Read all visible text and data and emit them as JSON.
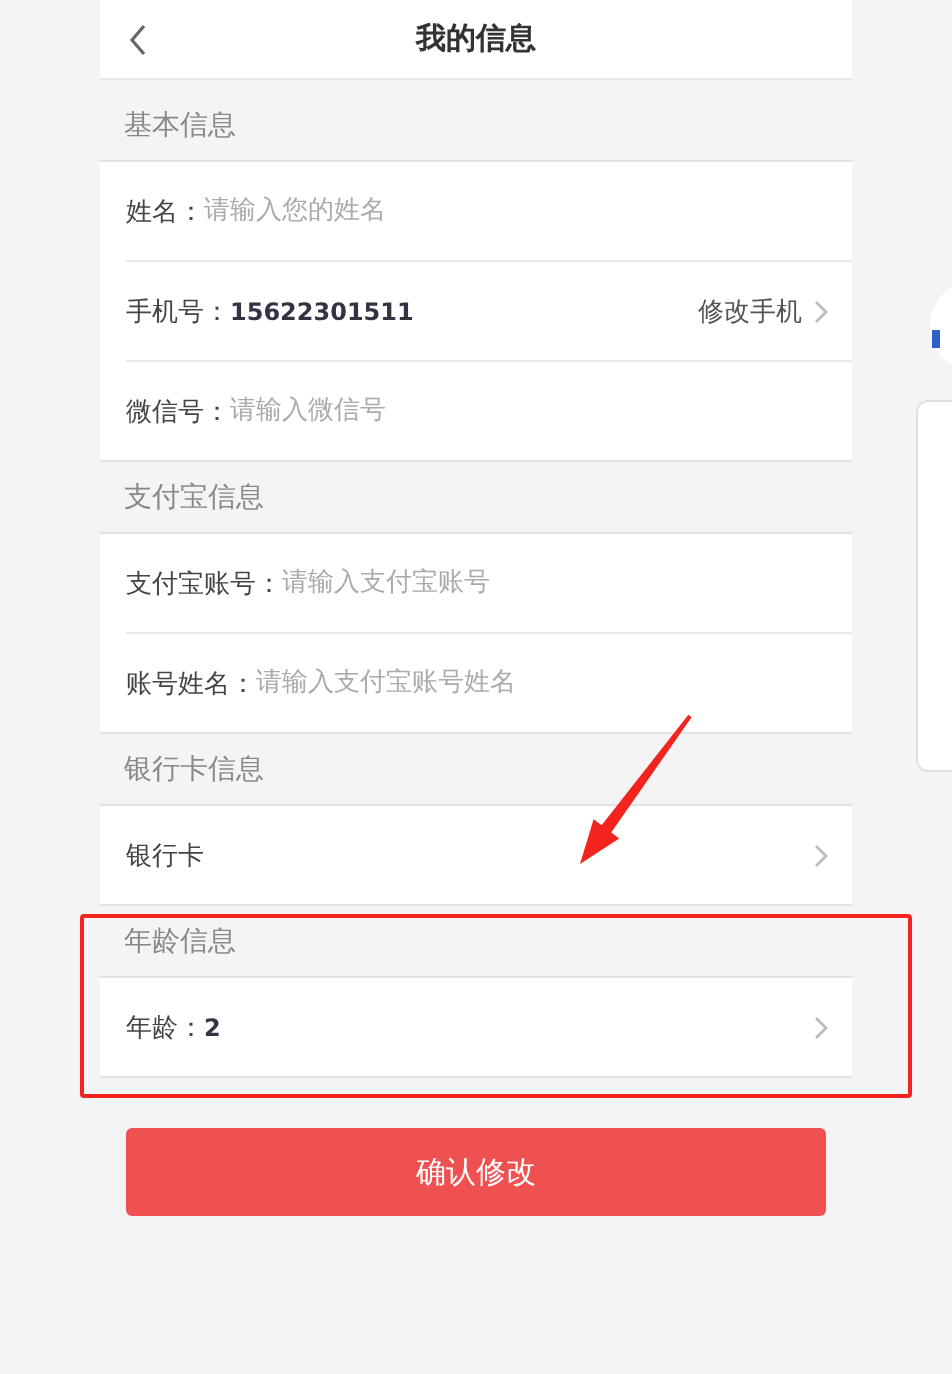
{
  "header": {
    "title": "我的信息"
  },
  "sections": [
    {
      "title": "基本信息",
      "rows": [
        {
          "kind": "input",
          "label": "姓名：",
          "placeholder": "请输入您的姓名"
        },
        {
          "kind": "value",
          "label": "手机号：",
          "value": "15622301511",
          "action": "修改手机"
        },
        {
          "kind": "input",
          "label": "微信号：",
          "placeholder": "请输入微信号"
        }
      ]
    },
    {
      "title": "支付宝信息",
      "rows": [
        {
          "kind": "input",
          "label": "支付宝账号：",
          "placeholder": "请输入支付宝账号"
        },
        {
          "kind": "input",
          "label": "账号姓名：",
          "placeholder": "请输入支付宝账号姓名"
        }
      ]
    },
    {
      "title": "银行卡信息",
      "rows": [
        {
          "kind": "link",
          "label": "银行卡"
        }
      ]
    },
    {
      "title": "年龄信息",
      "rows": [
        {
          "kind": "value",
          "label": "年龄：",
          "value": "2"
        }
      ]
    }
  ],
  "button": "确认修改"
}
